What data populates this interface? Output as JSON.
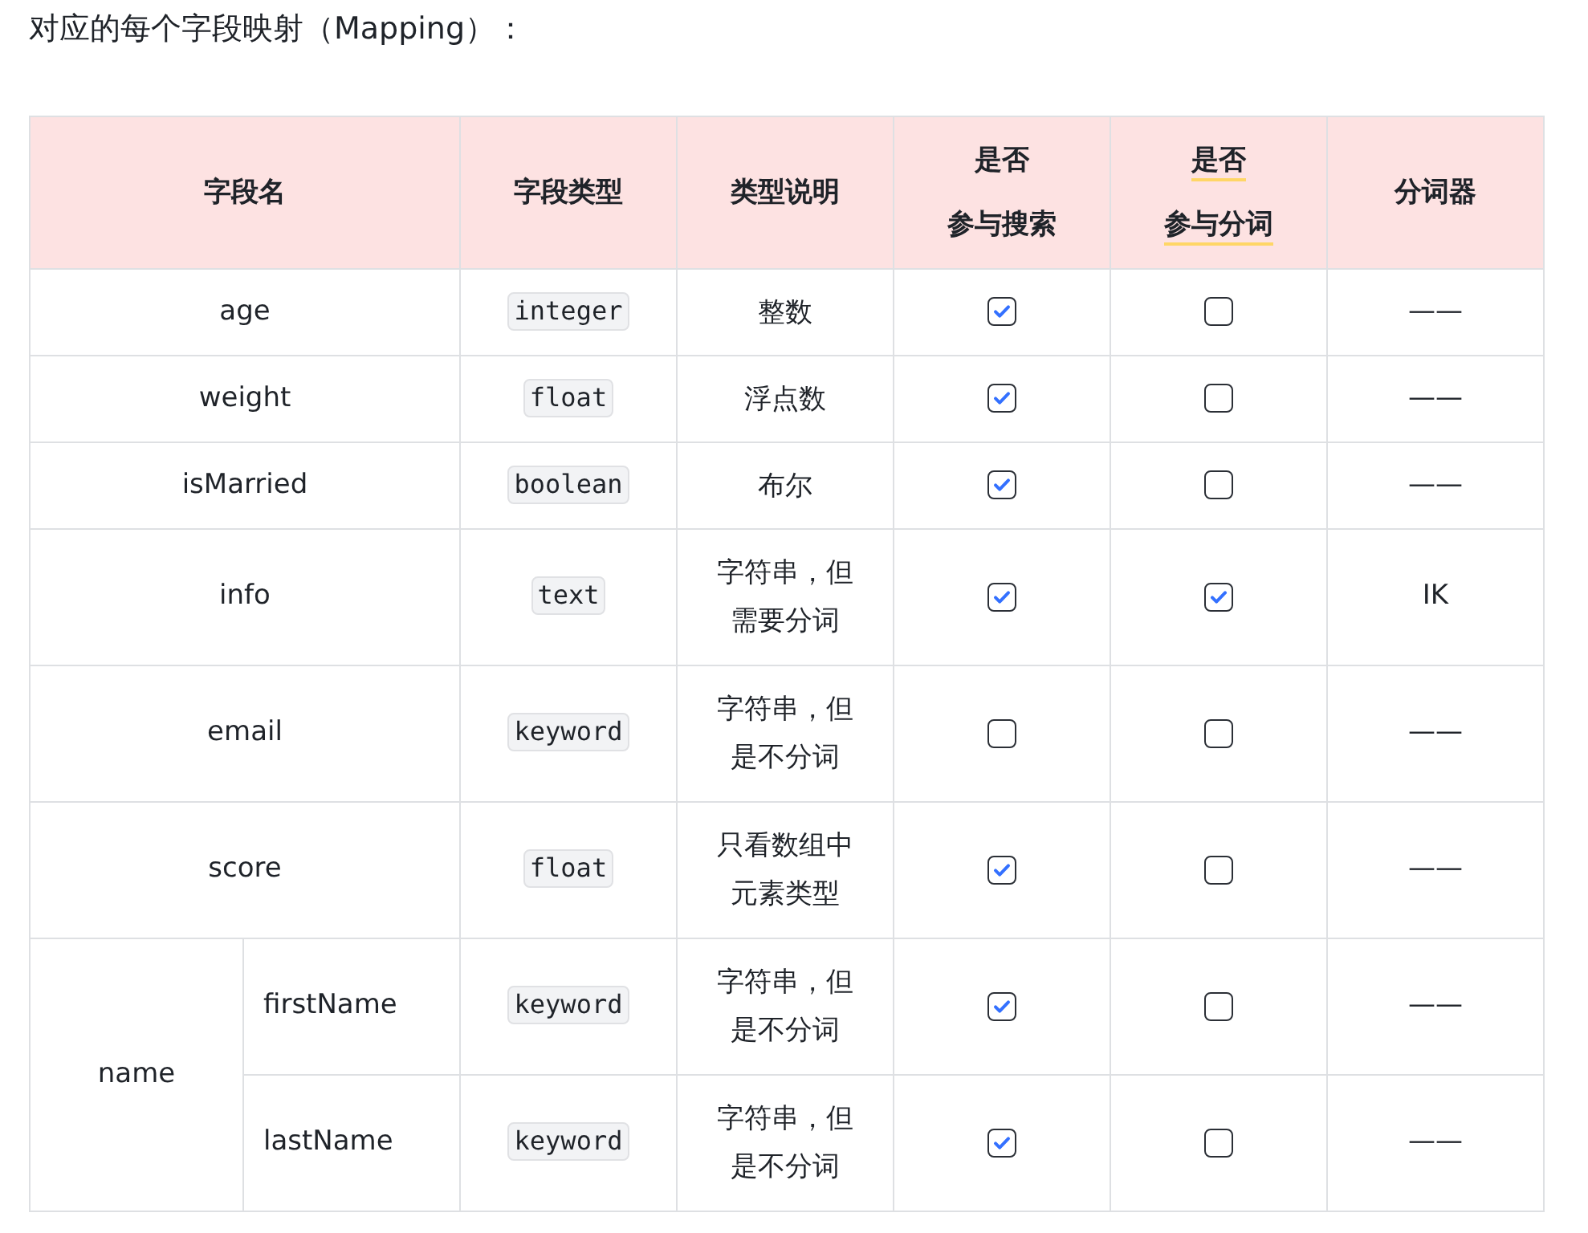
{
  "heading": "对应的每个字段映射（Mapping）：",
  "columns": [
    {
      "lines": [
        "字段名"
      ],
      "underlined": false
    },
    {
      "lines": [
        "字段类型"
      ],
      "underlined": false
    },
    {
      "lines": [
        "类型说明"
      ],
      "underlined": false
    },
    {
      "lines": [
        "是否",
        "参与搜索"
      ],
      "underlined": false
    },
    {
      "lines": [
        "是否",
        "参与分词"
      ],
      "underlined": true
    },
    {
      "lines": [
        "分词器"
      ],
      "underlined": false
    }
  ],
  "fields": [
    {
      "name": "age",
      "type": "integer",
      "description": "整数",
      "searchable": true,
      "analyzed": false,
      "analyzer": "——"
    },
    {
      "name": "weight",
      "type": "float",
      "description": "浮点数",
      "searchable": true,
      "analyzed": false,
      "analyzer": "——"
    },
    {
      "name": "isMarried",
      "type": "boolean",
      "description": "布尔",
      "searchable": true,
      "analyzed": false,
      "analyzer": "——"
    },
    {
      "name": "info",
      "type": "text",
      "description": "字符串，但需要分词",
      "searchable": true,
      "analyzed": true,
      "analyzer": "IK"
    },
    {
      "name": "email",
      "type": "keyword",
      "description": "字符串，但是不分词",
      "searchable": false,
      "analyzed": false,
      "analyzer": "——"
    },
    {
      "name": "score",
      "type": "float",
      "description": "只看数组中元素类型",
      "searchable": true,
      "analyzed": false,
      "analyzer": "——"
    },
    {
      "name": "name",
      "children": [
        {
          "name": "firstName",
          "type": "keyword",
          "description": "字符串，但是不分词",
          "searchable": true,
          "analyzed": false,
          "analyzer": "——"
        },
        {
          "name": "lastName",
          "type": "keyword",
          "description": "字符串，但是不分词",
          "searchable": true,
          "analyzed": false,
          "analyzer": "——"
        }
      ]
    }
  ]
}
